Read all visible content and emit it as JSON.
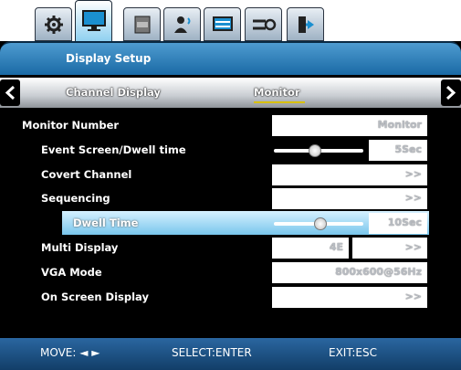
{
  "tabs": [
    {
      "icon": "gear-icon",
      "active": false
    },
    {
      "icon": "monitor-icon",
      "active": true
    },
    {
      "icon": "hdd-icon",
      "active": false
    },
    {
      "icon": "user-icon",
      "active": false
    },
    {
      "icon": "network-icon",
      "active": false
    },
    {
      "icon": "system-icon",
      "active": false
    },
    {
      "icon": "exit-icon",
      "active": false
    }
  ],
  "header": {
    "title": "Display Setup"
  },
  "nav": {
    "left": "Channel Display",
    "right": "Monitor"
  },
  "rows": {
    "monitor_number": {
      "label": "Monitor Number",
      "value": "Monitor"
    },
    "event_screen": {
      "label": "Event Screen/Dwell time",
      "value": "5Sec"
    },
    "covert_channel": {
      "label": "Covert Channel",
      "value": ">>"
    },
    "sequencing": {
      "label": "Sequencing",
      "value": ">>"
    },
    "dwell_time": {
      "label": "Dwell Time",
      "value": "10Sec"
    },
    "multi_display": {
      "label": "Multi Display",
      "value": "4E",
      "value2": ">>"
    },
    "vga_mode": {
      "label": "VGA Mode",
      "value": "800x600@56Hz"
    },
    "osd": {
      "label": "On Screen Display",
      "value": ">>"
    }
  },
  "footer": {
    "move": "MOVE: ◄ ►",
    "select": "SELECT:ENTER",
    "exit": "EXIT:ESC"
  },
  "colors": {
    "accent": "#1a6aa5",
    "selected": "#79c6ec"
  }
}
